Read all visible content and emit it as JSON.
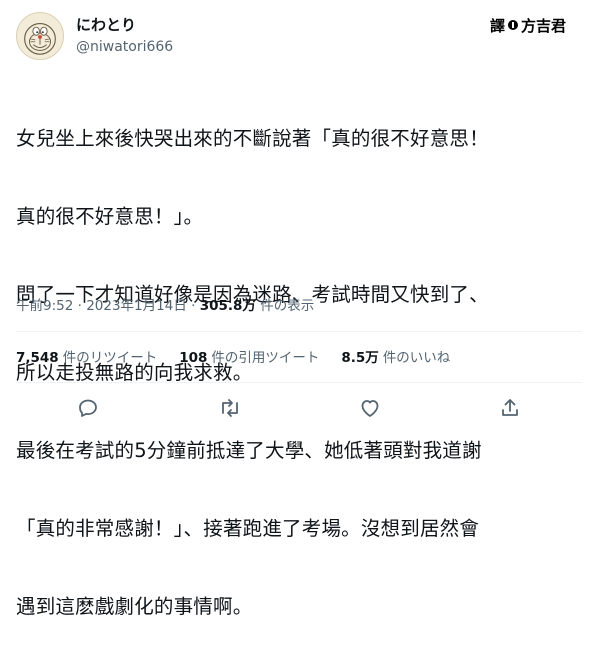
{
  "user": {
    "display_name": "にわとり",
    "handle": "@niwatori666"
  },
  "credit": {
    "label": "譯",
    "name": "方吉君"
  },
  "tweet": {
    "lines": [
      "女兒坐上來後快哭出來的不斷說著「真的很不好意思！",
      "真的很不好意思！」。",
      "問了一下才知道好像是因為迷路、考試時間又快到了、",
      "所以走投無路的向我求救。",
      "最後在考試的5分鐘前抵達了大學、她低著頭對我道謝",
      "「真的非常感謝！」、接著跑進了考場。沒想到居然會",
      "遇到這麽戲劇化的事情啊。"
    ]
  },
  "meta": {
    "time": "午前9:52",
    "separator": " · ",
    "date": "2023年1月14日",
    "views_count": "305.8万",
    "views_label": " 件の表示"
  },
  "stats": {
    "retweets": {
      "count": "7,548",
      "label": "件のリツイート"
    },
    "quotes": {
      "count": "108",
      "label": "件の引用ツイート"
    },
    "likes": {
      "count": "8.5万",
      "label": "件のいいね"
    }
  },
  "actions": [
    {
      "icon": "reply-icon"
    },
    {
      "icon": "retweet-icon"
    },
    {
      "icon": "like-icon"
    },
    {
      "icon": "share-icon"
    }
  ],
  "colors": {
    "text": "#0f1419",
    "secondary": "#536471",
    "divider": "#eff3f4"
  }
}
